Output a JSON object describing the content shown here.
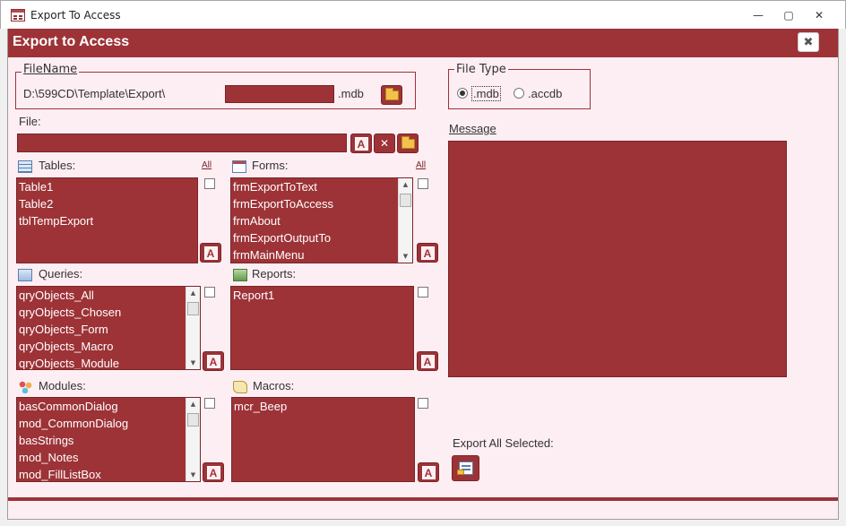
{
  "window": {
    "title": "Export To Access",
    "min": "—",
    "max": "▢",
    "close": "✕"
  },
  "header": {
    "title": "Export to Access",
    "close": "✖"
  },
  "filename": {
    "legend": "FileName",
    "path": "D:\\599CD\\Template\\Export\\",
    "name_value": "",
    "ext": ".mdb"
  },
  "filetype": {
    "legend": "File Type",
    "options": [
      ".mdb",
      ".accdb"
    ],
    "selected": ".mdb"
  },
  "file": {
    "label": "File:",
    "value": "",
    "clear": "✕"
  },
  "message": {
    "label": "Message",
    "value": ""
  },
  "tables": {
    "label": "Tables:",
    "all": "All",
    "items": [
      "Table1",
      "Table2",
      "tblTempExport"
    ]
  },
  "forms": {
    "label": "Forms:",
    "all": "All",
    "items": [
      "frmExportToText",
      "frmExportToAccess",
      "frmAbout",
      "frmExportOutputTo",
      "frmMainMenu"
    ]
  },
  "queries": {
    "label": "Queries:",
    "items": [
      "qryObjects_All",
      "qryObjects_Chosen",
      "qryObjects_Form",
      "qryObjects_Macro",
      "qryObjects_Module"
    ]
  },
  "reports": {
    "label": "Reports:",
    "items": [
      "Report1"
    ]
  },
  "modules": {
    "label": "Modules:",
    "items": [
      "basCommonDialog",
      "mod_CommonDialog",
      "basStrings",
      "mod_Notes",
      "mod_FillListBox"
    ]
  },
  "macros": {
    "label": "Macros:",
    "items": [
      "mcr_Beep"
    ]
  },
  "export": {
    "label": "Export All Selected:"
  },
  "accent": "#9d3337",
  "background": "#fdeef3"
}
